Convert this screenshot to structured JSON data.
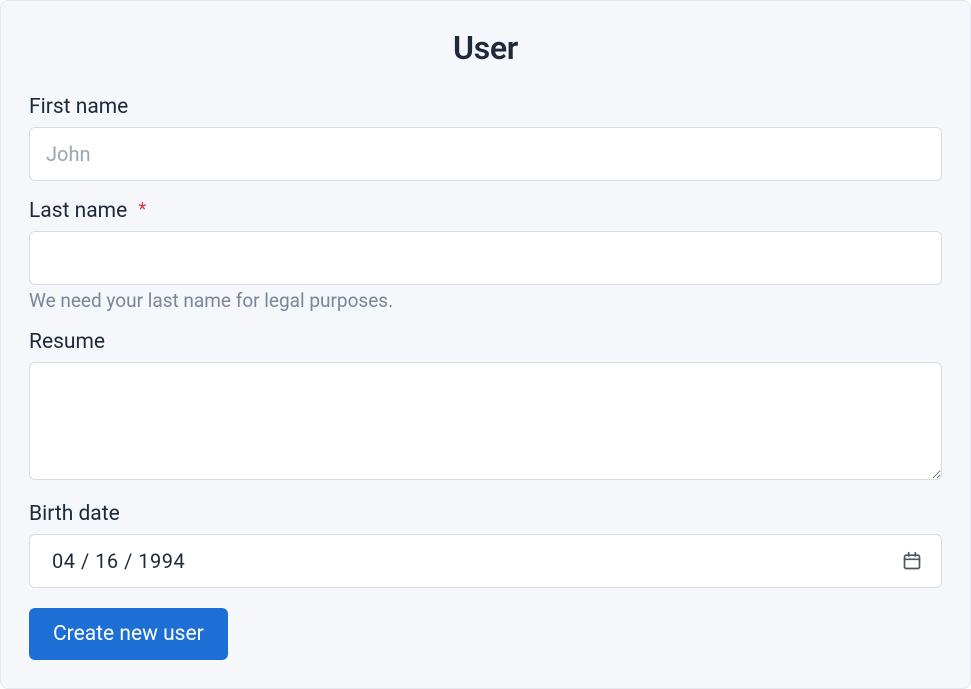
{
  "form": {
    "title": "User",
    "fields": {
      "first_name": {
        "label": "First name",
        "placeholder": "John",
        "value": ""
      },
      "last_name": {
        "label": "Last name",
        "required_marker": "*",
        "value": "",
        "help_text": "We need your last name for legal purposes."
      },
      "resume": {
        "label": "Resume",
        "value": ""
      },
      "birth_date": {
        "label": "Birth date",
        "value": "04 / 16 / 1994"
      }
    },
    "submit_label": "Create new user"
  }
}
